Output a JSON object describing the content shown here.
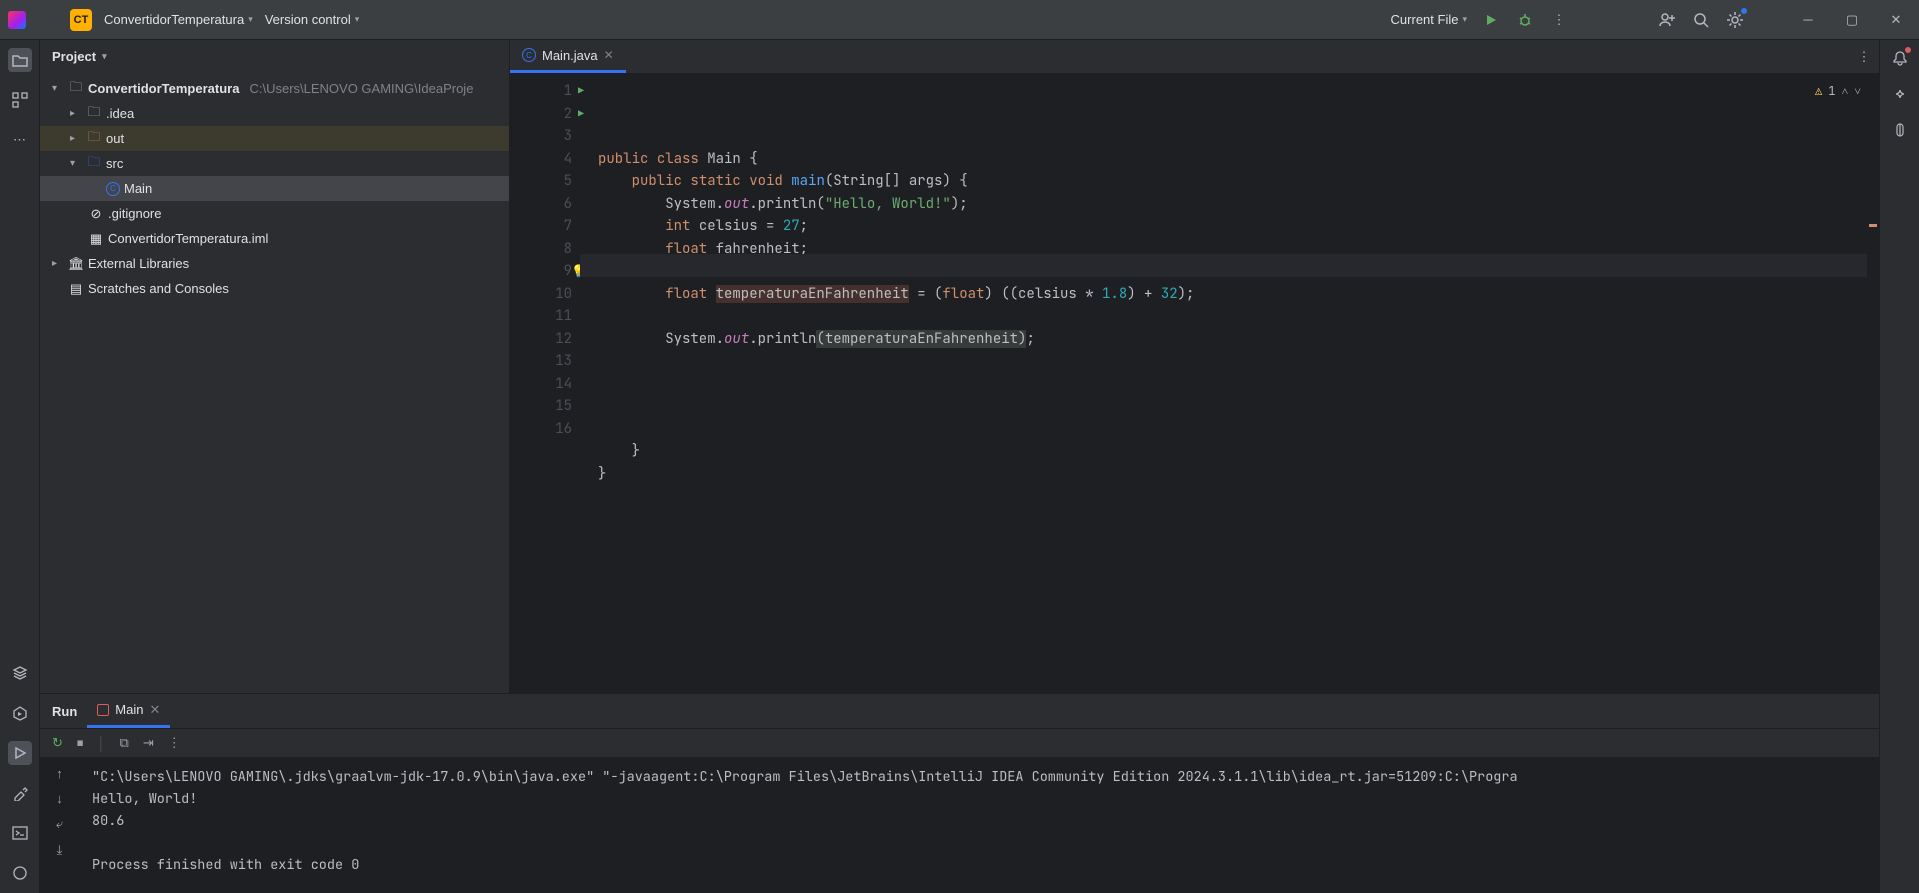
{
  "titlebar": {
    "project_badge": "CT",
    "project_name": "ConvertidorTemperatura",
    "vcs_label": "Version control",
    "run_config": "Current File"
  },
  "project_panel": {
    "title": "Project",
    "root": "ConvertidorTemperatura",
    "root_path": "C:\\Users\\LENOVO GAMING\\IdeaProje",
    "idea": ".idea",
    "out": "out",
    "src": "src",
    "main_class": "Main",
    "gitignore": ".gitignore",
    "iml": "ConvertidorTemperatura.iml",
    "external": "External Libraries",
    "scratches": "Scratches and Consoles"
  },
  "tab": {
    "name": "Main.java"
  },
  "inspections": {
    "warn_count": "1"
  },
  "code": {
    "l1a": "public",
    "l1b": "class",
    "l1c": "Main {",
    "l2a": "public",
    "l2b": "static",
    "l2c": "void",
    "l2d": "main",
    "l2e": "(String[] args) {",
    "l3a": "System.",
    "l3b": "out",
    "l3c": ".println(",
    "l3d": "\"Hello, World!\"",
    "l3e": ");",
    "l4a": "int",
    "l4b": "celsius = ",
    "l4c": "27",
    "l4d": ";",
    "l5a": "float",
    "l5b": "fahrenheit;",
    "l7a": "float",
    "l7b": "temperaturaEnFahrenheit",
    "l7c": " = (",
    "l7d": "float",
    "l7e": ") ((celsius * ",
    "l7f": "1.8",
    "l7g": ") + ",
    "l7h": "32",
    "l7i": ");",
    "l9a": "System.",
    "l9b": "out",
    "l9c": ".println",
    "l9d": "(",
    "l9e": "temperaturaEnFahrenheit",
    "l9f": ")",
    "l9g": ";",
    "l15": "}",
    "l16": "}"
  },
  "run": {
    "title": "Run",
    "config": "Main",
    "out1": "\"C:\\Users\\LENOVO GAMING\\.jdks\\graalvm-jdk-17.0.9\\bin\\java.exe\" \"-javaagent:C:\\Program Files\\JetBrains\\IntelliJ IDEA Community Edition 2024.3.1.1\\lib\\idea_rt.jar=51209:C:\\Progra",
    "out2": "Hello, World!",
    "out3": "80.6",
    "out4": "",
    "out5": "Process finished with exit code 0"
  }
}
